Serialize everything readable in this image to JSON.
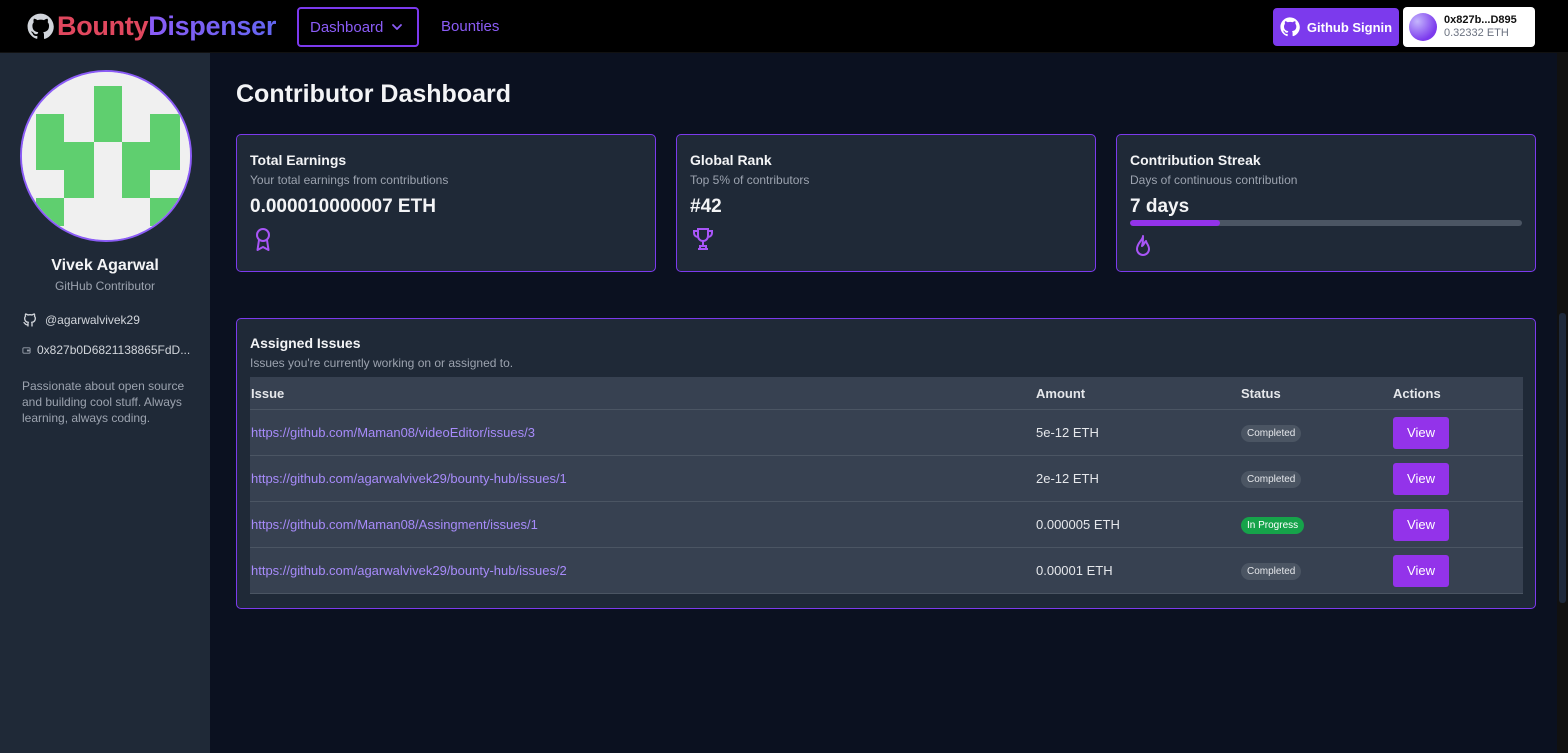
{
  "navbar": {
    "brand_part1": "Bounty",
    "brand_part2": "Dispenser",
    "dashboard_label": "Dashboard",
    "bounties_label": "Bounties",
    "github_signin_label": "Github Signin",
    "wallet_address": "0x827b...D895",
    "wallet_balance": "0.32332 ETH"
  },
  "profile": {
    "name": "Vivek Agarwal",
    "role": "GitHub Contributor",
    "github_handle": "@agarwalvivek29",
    "wallet": "0x827b0D6821138865FdD...",
    "bio": "Passionate about open source and building cool stuff. Always learning, always coding."
  },
  "page": {
    "title": "Contributor Dashboard"
  },
  "stats": {
    "earnings": {
      "title": "Total Earnings",
      "subtitle": "Your total earnings from contributions",
      "value": "0.000010000007 ETH",
      "icon": "award-icon"
    },
    "rank": {
      "title": "Global Rank",
      "subtitle": "Top 5% of contributors",
      "value": "#42",
      "icon": "trophy-icon"
    },
    "streak": {
      "title": "Contribution Streak",
      "subtitle": "Days of continuous contribution",
      "value": "7 days",
      "progress": 0.23,
      "icon": "flame-icon"
    }
  },
  "issues": {
    "title": "Assigned Issues",
    "subtitle": "Issues you're currently working on or assigned to.",
    "columns": [
      "Issue",
      "Amount",
      "Status",
      "Actions"
    ],
    "rows": [
      {
        "issue": "https://github.com/Maman08/videoEditor/issues/3",
        "amount": "5e-12 ETH",
        "status": "Completed",
        "action": "View"
      },
      {
        "issue": "https://github.com/agarwalvivek29/bounty-hub/issues/1",
        "amount": "2e-12 ETH",
        "status": "Completed",
        "action": "View"
      },
      {
        "issue": "https://github.com/Maman08/Assingment/issues/1",
        "amount": "0.000005 ETH",
        "status": "In Progress",
        "action": "View"
      },
      {
        "issue": "https://github.com/agarwalvivek29/bounty-hub/issues/2",
        "amount": "0.00001 ETH",
        "status": "Completed",
        "action": "View"
      }
    ]
  },
  "colors": {
    "accent": "#7c3aed",
    "brand_red": "#e0475e",
    "link": "#a78bfa",
    "success": "#16a34a",
    "identicon": "#5fcf6f"
  }
}
